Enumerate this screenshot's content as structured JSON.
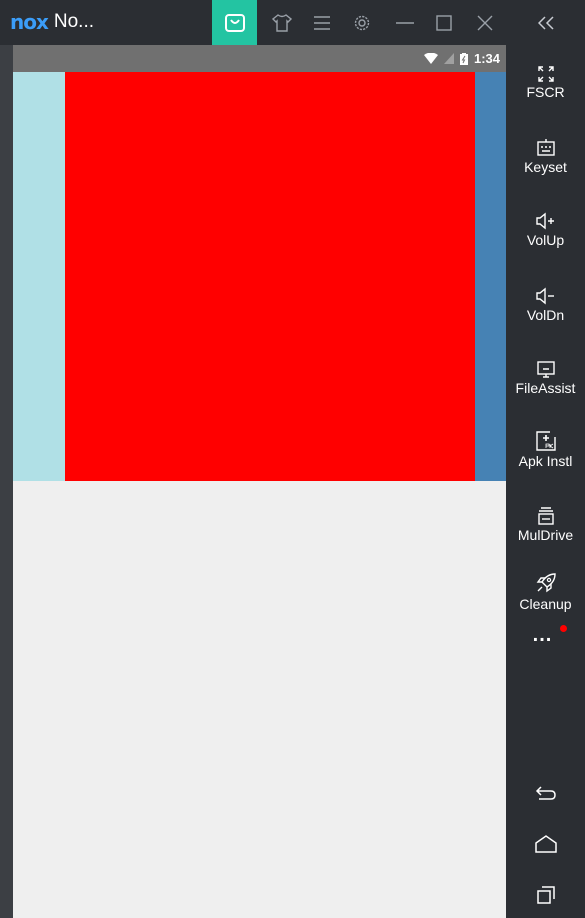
{
  "window": {
    "logo_text": "nox",
    "title": "No..."
  },
  "toolbar": {
    "icons": [
      "store-icon",
      "skin-icon",
      "menu-icon",
      "settings-icon",
      "minimize-icon",
      "maximize-icon",
      "close-icon"
    ],
    "store_active_color": "#23c4a2"
  },
  "statusbar": {
    "time": "1:34",
    "icons": [
      "wifi-icon",
      "signal-icon",
      "battery-icon"
    ]
  },
  "screen": {
    "panels": [
      {
        "color": "#b0e0e6"
      },
      {
        "color": "#ff0000"
      },
      {
        "color": "#4682b4"
      }
    ],
    "background": "#efefef"
  },
  "sidebar": {
    "items": [
      {
        "label": "FSCR",
        "icon": "fullscreen-icon"
      },
      {
        "label": "Keyset",
        "icon": "keyboard-icon"
      },
      {
        "label": "VolUp",
        "icon": "volume-up-icon"
      },
      {
        "label": "VolDn",
        "icon": "volume-down-icon"
      },
      {
        "label": "FileAssist",
        "icon": "file-assist-icon"
      },
      {
        "label": "Apk Instl",
        "icon": "apk-install-icon"
      },
      {
        "label": "MulDrive",
        "icon": "multi-drive-icon"
      },
      {
        "label": "Cleanup",
        "icon": "rocket-icon"
      }
    ],
    "more_label": "...",
    "notification_dot_color": "#ff0000",
    "nav": [
      "back-icon",
      "home-icon",
      "recents-icon"
    ]
  }
}
